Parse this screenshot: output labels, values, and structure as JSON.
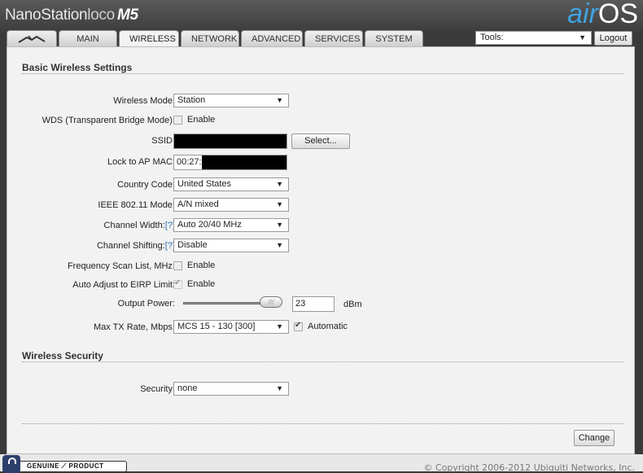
{
  "header": {
    "brand_name": "NanoStation",
    "brand_model": "loco",
    "brand_suffix": "M5",
    "os_air": "air",
    "os_name": "OS"
  },
  "tabs": [
    {
      "label": "",
      "icon": "ubiquiti-logo-icon"
    },
    {
      "label": "MAIN"
    },
    {
      "label": "WIRELESS",
      "active": true
    },
    {
      "label": "NETWORK"
    },
    {
      "label": "ADVANCED"
    },
    {
      "label": "SERVICES"
    },
    {
      "label": "SYSTEM"
    }
  ],
  "tools": {
    "label": "Tools:"
  },
  "logout_label": "Logout",
  "basic": {
    "title": "Basic Wireless Settings",
    "wireless_mode": {
      "label": "Wireless Mode:",
      "value": "Station"
    },
    "wds": {
      "label": "WDS (Transparent Bridge Mode):",
      "checkbox_label": "Enable",
      "checked": false
    },
    "ssid": {
      "label": "SSID:",
      "value": "",
      "select_label": "Select..."
    },
    "lock_ap": {
      "label": "Lock to AP MAC:",
      "value": "00:27:"
    },
    "country": {
      "label": "Country Code:",
      "value": "United States"
    },
    "ieee": {
      "label": "IEEE 802.11 Mode:",
      "value": "A/N mixed"
    },
    "channel_width": {
      "label": "Channel Width:",
      "help": "[?]",
      "value": "Auto 20/40 MHz"
    },
    "channel_shifting": {
      "label": "Channel Shifting:",
      "help": "[?]",
      "value": "Disable"
    },
    "freq_scan": {
      "label": "Frequency Scan List, MHz:",
      "checkbox_label": "Enable",
      "checked": false
    },
    "auto_adjust": {
      "label": "Auto Adjust to EIRP Limit:",
      "checkbox_label": "Enable",
      "checked": true
    },
    "output_power": {
      "label": "Output Power:",
      "value": "23",
      "unit": "dBm",
      "slider_level": 0.88
    },
    "max_tx": {
      "label": "Max TX Rate, Mbps:",
      "value": "MCS 15 - 130 [300]",
      "auto_label": "Automatic",
      "auto_checked": true
    }
  },
  "security": {
    "title": "Wireless Security",
    "label": "Security:",
    "value": "none"
  },
  "change_label": "Change",
  "footer": {
    "badge": "GENUINE ⟋ PRODUCT",
    "copyright": "© Copyright 2006-2012 Ubiquiti Networks, Inc."
  },
  "colors": {
    "accent": "#3ea3e0",
    "background": "#f2f2f2",
    "header": "#3c3c3c"
  }
}
